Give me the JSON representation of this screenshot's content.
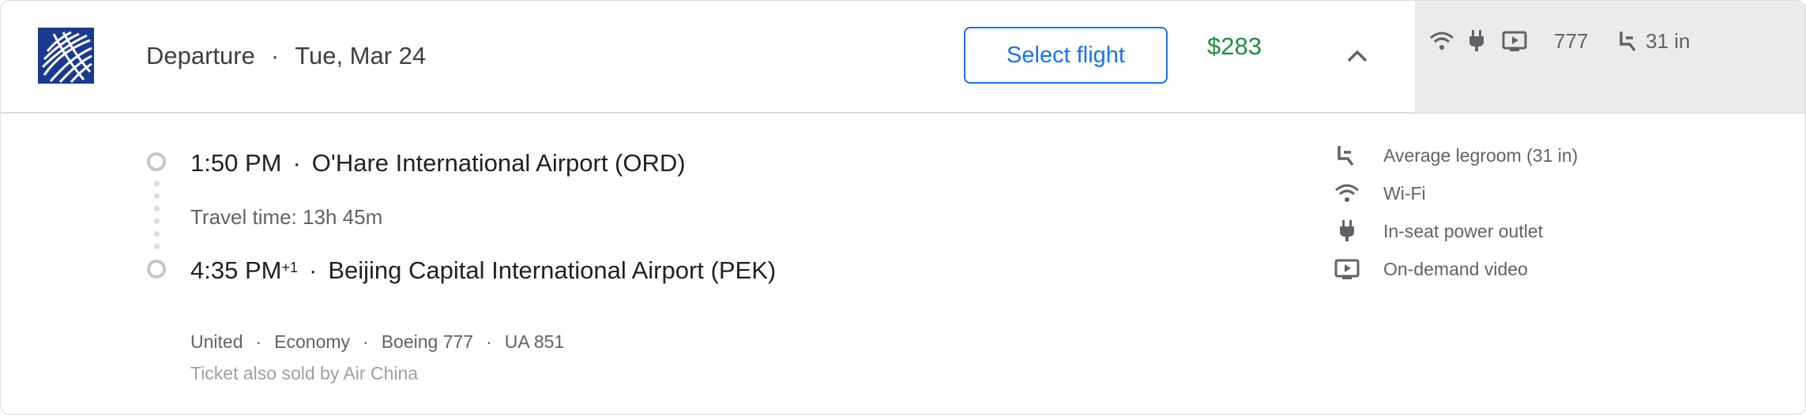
{
  "header": {
    "airline_logo_icon": "united-globe-icon",
    "direction_label": "Departure",
    "date": "Tue, Mar 24",
    "select_button_label": "Select flight",
    "price": "$283",
    "collapse_icon": "chevron-up-icon",
    "amenities_strip": {
      "aircraft": "777",
      "legroom": "31 in"
    }
  },
  "segment": {
    "departure": {
      "time": "1:50 PM",
      "airport": "O'Hare International Airport (ORD)"
    },
    "travel_time": "Travel time: 13h 45m",
    "arrival": {
      "time": "4:35 PM",
      "day_offset": "+1",
      "airport": "Beijing Capital International Airport (PEK)"
    },
    "airline": "United",
    "cabin": "Economy",
    "aircraft": "Boeing 777",
    "flight_number": "UA 851",
    "sold_by": "Ticket also sold by Air China"
  },
  "amenities": [
    {
      "icon": "legroom-seat-icon",
      "label": "Average legroom (31 in)"
    },
    {
      "icon": "wifi-icon",
      "label": "Wi-Fi"
    },
    {
      "icon": "power-plug-icon",
      "label": "In-seat power outlet"
    },
    {
      "icon": "video-screen-icon",
      "label": "On-demand video"
    }
  ],
  "colors": {
    "accent_blue": "#1a73e8",
    "price_green": "#1e8e3e",
    "united_blue": "#1a3a8f",
    "text_primary": "#202124",
    "text_secondary": "#5f6368",
    "strip_bg": "#ebebeb"
  }
}
